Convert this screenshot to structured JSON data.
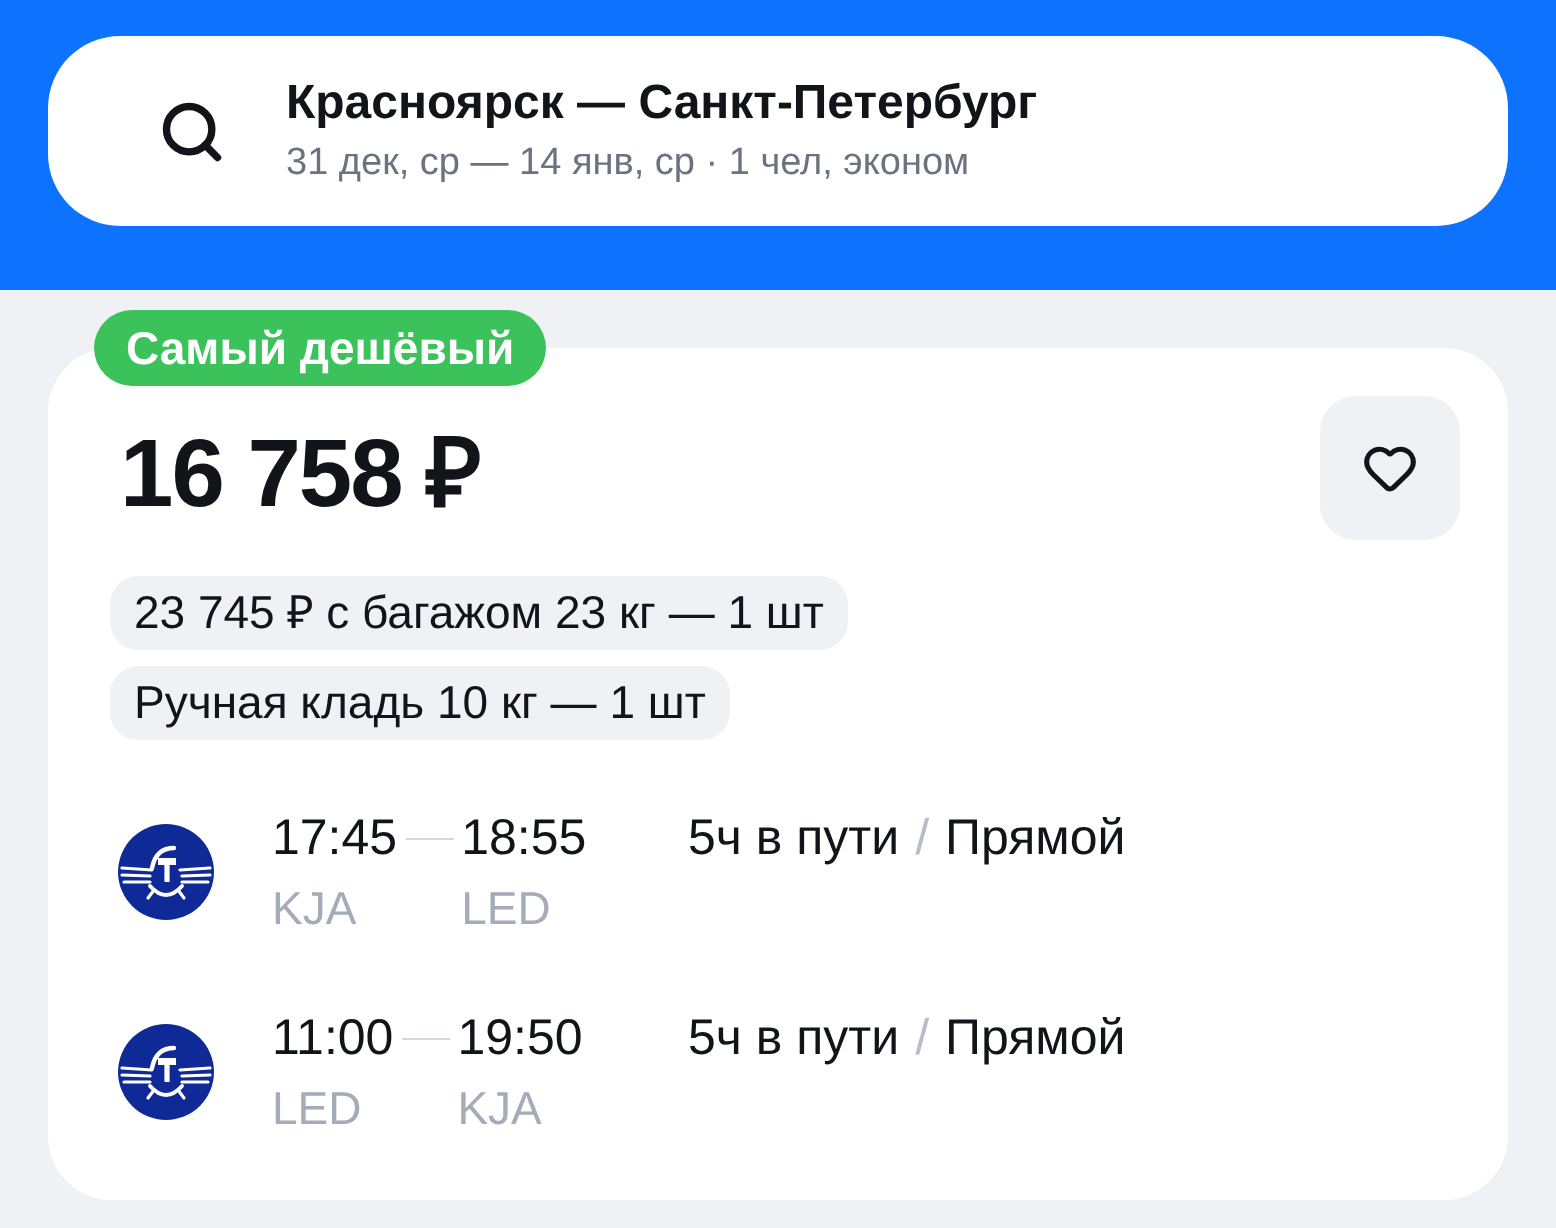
{
  "search": {
    "route": "Красноярск — Санкт-Петербург",
    "details": "31 дек, ср — 14 янв, ср · 1 чел, эконом"
  },
  "offer": {
    "badge": "Самый дешёвый",
    "price": "16 758 ₽",
    "favorite": false,
    "tags": [
      "23 745 ₽ с багажом 23 кг — 1 шт",
      "Ручная кладь 10 кг — 1 шт"
    ],
    "flights": [
      {
        "departure_time": "17:45",
        "arrival_time": "18:55",
        "departure_airport": "KJA",
        "arrival_airport": "LED",
        "duration": "5ч в пути",
        "separator": "/",
        "stops": "Прямой"
      },
      {
        "departure_time": "11:00",
        "arrival_time": "19:50",
        "departure_airport": "LED",
        "arrival_airport": "KJA",
        "duration": "5ч в пути",
        "separator": "/",
        "stops": "Прямой"
      }
    ]
  }
}
